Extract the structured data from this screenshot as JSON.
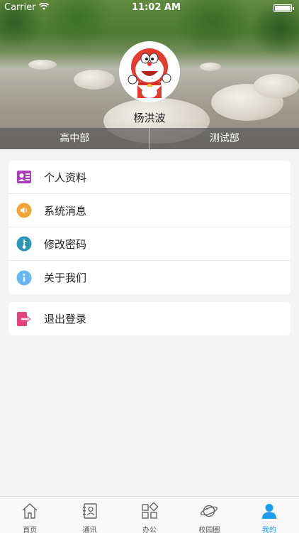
{
  "status_bar": {
    "carrier": "Carrier",
    "time": "11:02 AM"
  },
  "profile": {
    "name": "杨洪波",
    "departments": [
      "高中部",
      "测试部"
    ]
  },
  "menu": [
    {
      "label": "个人资料",
      "icon": "profile-card-icon"
    },
    {
      "label": "系统消息",
      "icon": "speaker-icon"
    },
    {
      "label": "修改密码",
      "icon": "key-icon"
    },
    {
      "label": "关于我们",
      "icon": "info-icon"
    }
  ],
  "logout": {
    "label": "退出登录",
    "icon": "logout-icon"
  },
  "tabs": [
    {
      "label": "首页",
      "icon": "home-icon"
    },
    {
      "label": "通讯",
      "icon": "contacts-icon"
    },
    {
      "label": "办公",
      "icon": "office-grid-icon"
    },
    {
      "label": "校园圈",
      "icon": "planet-icon"
    },
    {
      "label": "我的",
      "icon": "person-icon",
      "active": true
    }
  ],
  "colors": {
    "accent": "#1e9cf0",
    "profile_icon": "#a93fb8",
    "message_icon": "#f2a33a",
    "key_icon": "#2b96b8",
    "info_icon": "#69b6f5",
    "logout_icon": "#e2457e"
  }
}
